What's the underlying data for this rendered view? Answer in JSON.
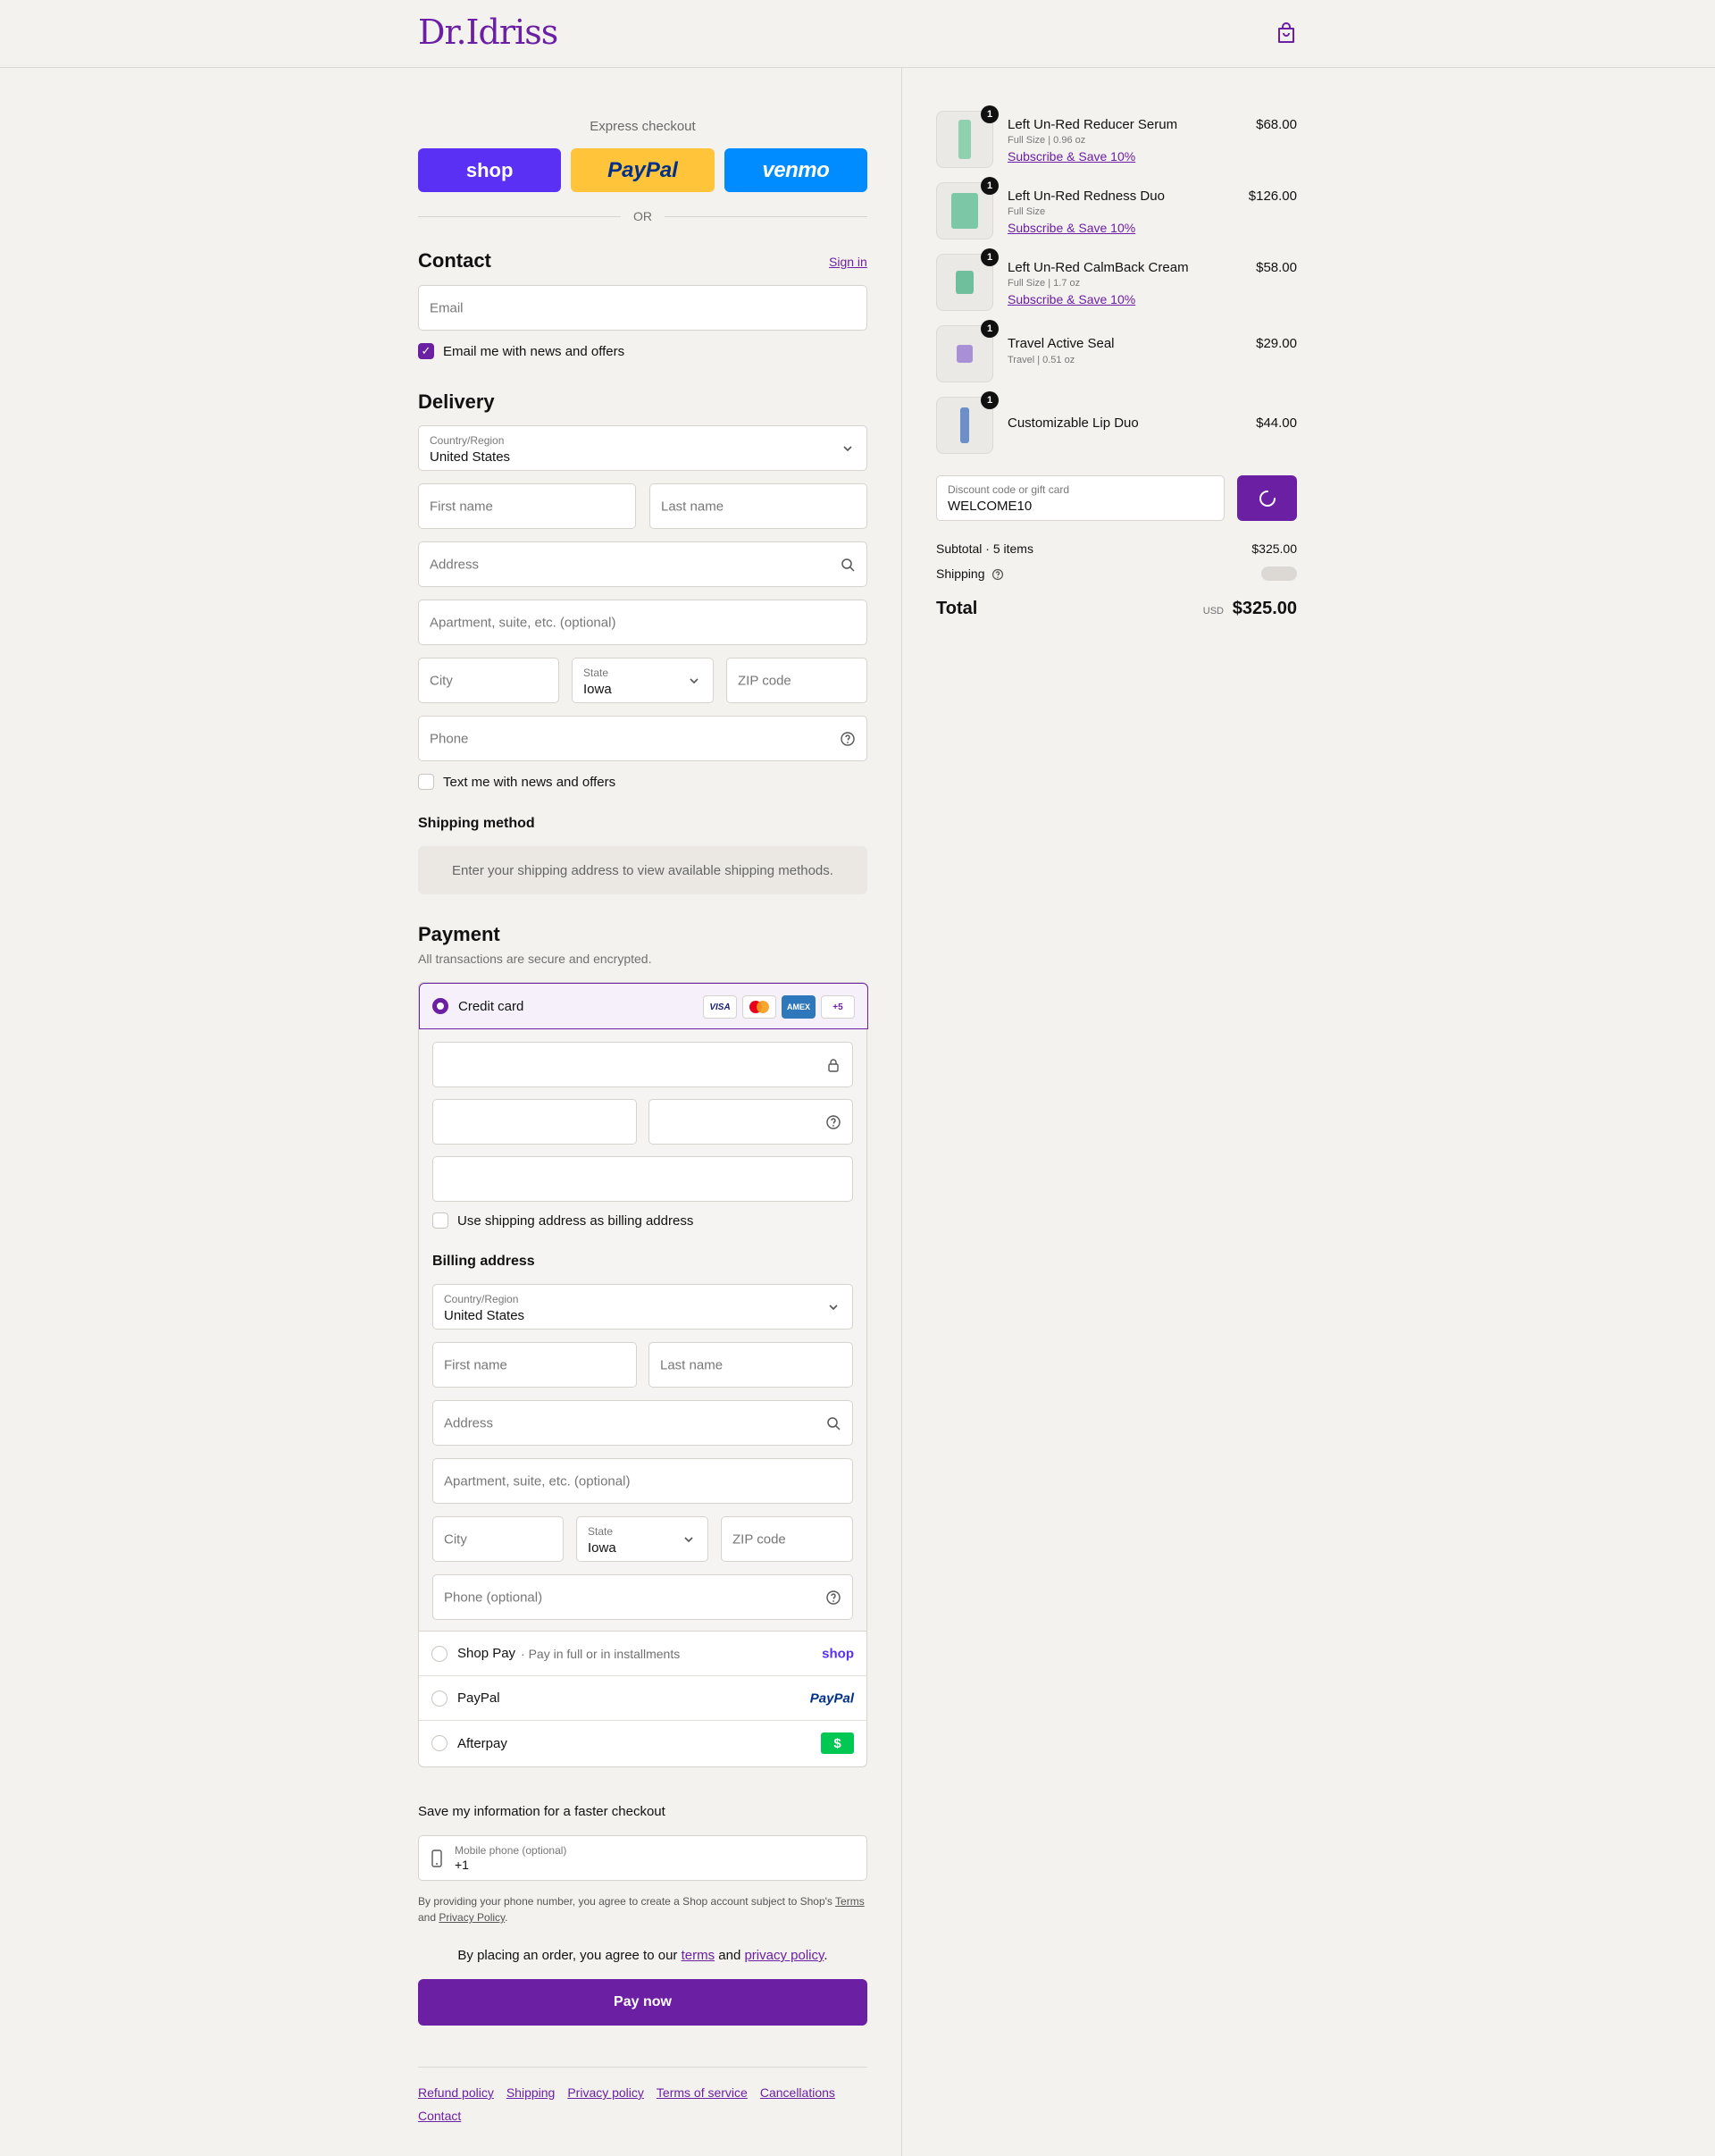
{
  "brand": {
    "logo_text": "Dr.Idriss",
    "accent": "#6b1fa3"
  },
  "express": {
    "label": "Express checkout",
    "buttons": [
      "shop",
      "PayPal",
      "venmo"
    ],
    "or": "OR"
  },
  "contact": {
    "title": "Contact",
    "sign_in": "Sign in",
    "email_placeholder": "Email",
    "news_checkbox": "Email me with news and offers",
    "news_checked": true
  },
  "delivery": {
    "title": "Delivery",
    "country_label": "Country/Region",
    "country_value": "United States",
    "first_name": "First name",
    "last_name": "Last name",
    "address": "Address",
    "apartment": "Apartment, suite, etc. (optional)",
    "city": "City",
    "state_label": "State",
    "state_value": "Iowa",
    "zip": "ZIP code",
    "phone": "Phone",
    "text_checkbox": "Text me with news and offers"
  },
  "shipping": {
    "title": "Shipping method",
    "message": "Enter your shipping address to view available shipping methods."
  },
  "payment": {
    "title": "Payment",
    "subtitle": "All transactions are secure and encrypted.",
    "credit_card": "Credit card",
    "card_logos": [
      "VISA",
      "MC",
      "AMEX",
      "+5"
    ],
    "use_shipping": "Use shipping address as billing address",
    "billing_title": "Billing address",
    "billing": {
      "country_label": "Country/Region",
      "country_value": "United States",
      "first_name": "First name",
      "last_name": "Last name",
      "address": "Address",
      "apartment": "Apartment, suite, etc. (optional)",
      "city": "City",
      "state_label": "State",
      "state_value": "Iowa",
      "zip": "ZIP code",
      "phone": "Phone (optional)"
    },
    "shop_pay": "Shop Pay",
    "shop_pay_sub": "· Pay in full or in installments",
    "shop_pay_logo": "shop",
    "paypal": "PayPal",
    "paypal_logo": "PayPal",
    "afterpay": "Afterpay",
    "afterpay_logo": "$"
  },
  "save": {
    "title": "Save my information for a faster checkout",
    "phone_label": "Mobile phone (optional)",
    "phone_value": "+1",
    "disclaimer_1": "By providing your phone number, you agree to create a Shop account subject to Shop's",
    "terms": "Terms",
    "and": "and",
    "privacy": "Privacy Policy",
    "period": "."
  },
  "agree": {
    "prefix": "By placing an order, you agree to our",
    "terms": "terms",
    "and": "and",
    "privacy": "privacy policy",
    "suffix": "."
  },
  "pay_now": "Pay now",
  "footer": [
    "Refund policy",
    "Shipping",
    "Privacy policy",
    "Terms of service",
    "Cancellations",
    "Contact"
  ],
  "summary": {
    "items": [
      {
        "qty": "1",
        "name": "Left Un-Red Reducer Serum",
        "meta": "Full Size | 0.96 oz",
        "subscribe": "Subscribe & Save 10%",
        "price": "$68.00",
        "color": "#8fd0ae"
      },
      {
        "qty": "1",
        "name": "Left Un-Red Redness Duo",
        "meta": "Full Size",
        "subscribe": "Subscribe & Save 10%",
        "price": "$126.00",
        "color": "#7cc7a5"
      },
      {
        "qty": "1",
        "name": "Left Un-Red CalmBack Cream",
        "meta": "Full Size | 1.7 oz",
        "subscribe": "Subscribe & Save 10%",
        "price": "$58.00",
        "color": "#6fbf9c"
      },
      {
        "qty": "1",
        "name": "Travel Active Seal",
        "meta": "Travel | 0.51 oz",
        "subscribe": "",
        "price": "$29.00",
        "color": "#a98fd6"
      },
      {
        "qty": "1",
        "name": "Customizable Lip Duo",
        "meta": "",
        "subscribe": "",
        "price": "$44.00",
        "color": "#6c8fc9"
      }
    ],
    "discount_label": "Discount code or gift card",
    "discount_value": "WELCOME10",
    "subtotal_label": "Subtotal · 5 items",
    "subtotal_value": "$325.00",
    "shipping_label": "Shipping",
    "total_label": "Total",
    "currency": "USD",
    "total_value": "$325.00"
  }
}
